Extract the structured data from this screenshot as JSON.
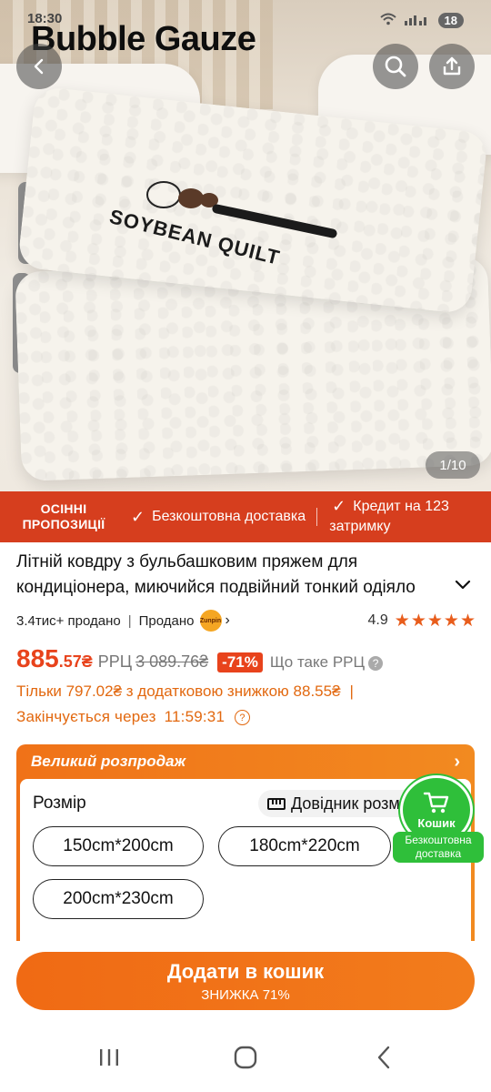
{
  "status_bar": {
    "time": "18:30",
    "battery": "18"
  },
  "hero": {
    "watermark": "Bubble Gauze",
    "brand_print": "SOYBEAN QUILT",
    "counter": "1/10"
  },
  "promo": {
    "autumn_line1": "ОСІННІ",
    "autumn_line2": "ПРОПОЗИЦІЇ",
    "free_delivery": "Безкоштовна доставка",
    "credit_line1": "Кредит на 123",
    "credit_line2": "затримку"
  },
  "product": {
    "title": "Літній ковдру з бульбашковим пряжем для кондиціонера, миючийся подвійний тонкий одіяло",
    "sold": "3.4тис+ продано",
    "sold_by": "Продано",
    "seller_badge": "Zunpin",
    "rating": "4.9",
    "stars": 5
  },
  "price": {
    "main": "885",
    "cents": ".57₴",
    "rrp_label": "РРЦ",
    "rrp_value": "3 089.76₴",
    "discount": "-71%",
    "what_rrp": "Що таке РРЦ",
    "extra_discount": "Тільки 797.02₴ з додатковою знижкою 88.55₴",
    "ends_label": "Закінчується через",
    "timer": "11:59:31"
  },
  "sale": {
    "title": "Великий розпродаж",
    "size_label": "Розмір",
    "size_guide": "Довідник розмірів",
    "sizes": [
      "150cm*200cm",
      "180cm*220cm",
      "200cm*230cm"
    ]
  },
  "cart_float": {
    "label": "Кошик",
    "free_line1": "Безкоштовна",
    "free_line2": "доставка"
  },
  "cta": {
    "main": "Додати в кошик",
    "sub": "ЗНИЖКА 71%"
  },
  "colors": {
    "accent": "#e8431c",
    "orange": "#f07218",
    "promo_red": "#d63e1e",
    "green": "#2fbf3a"
  }
}
